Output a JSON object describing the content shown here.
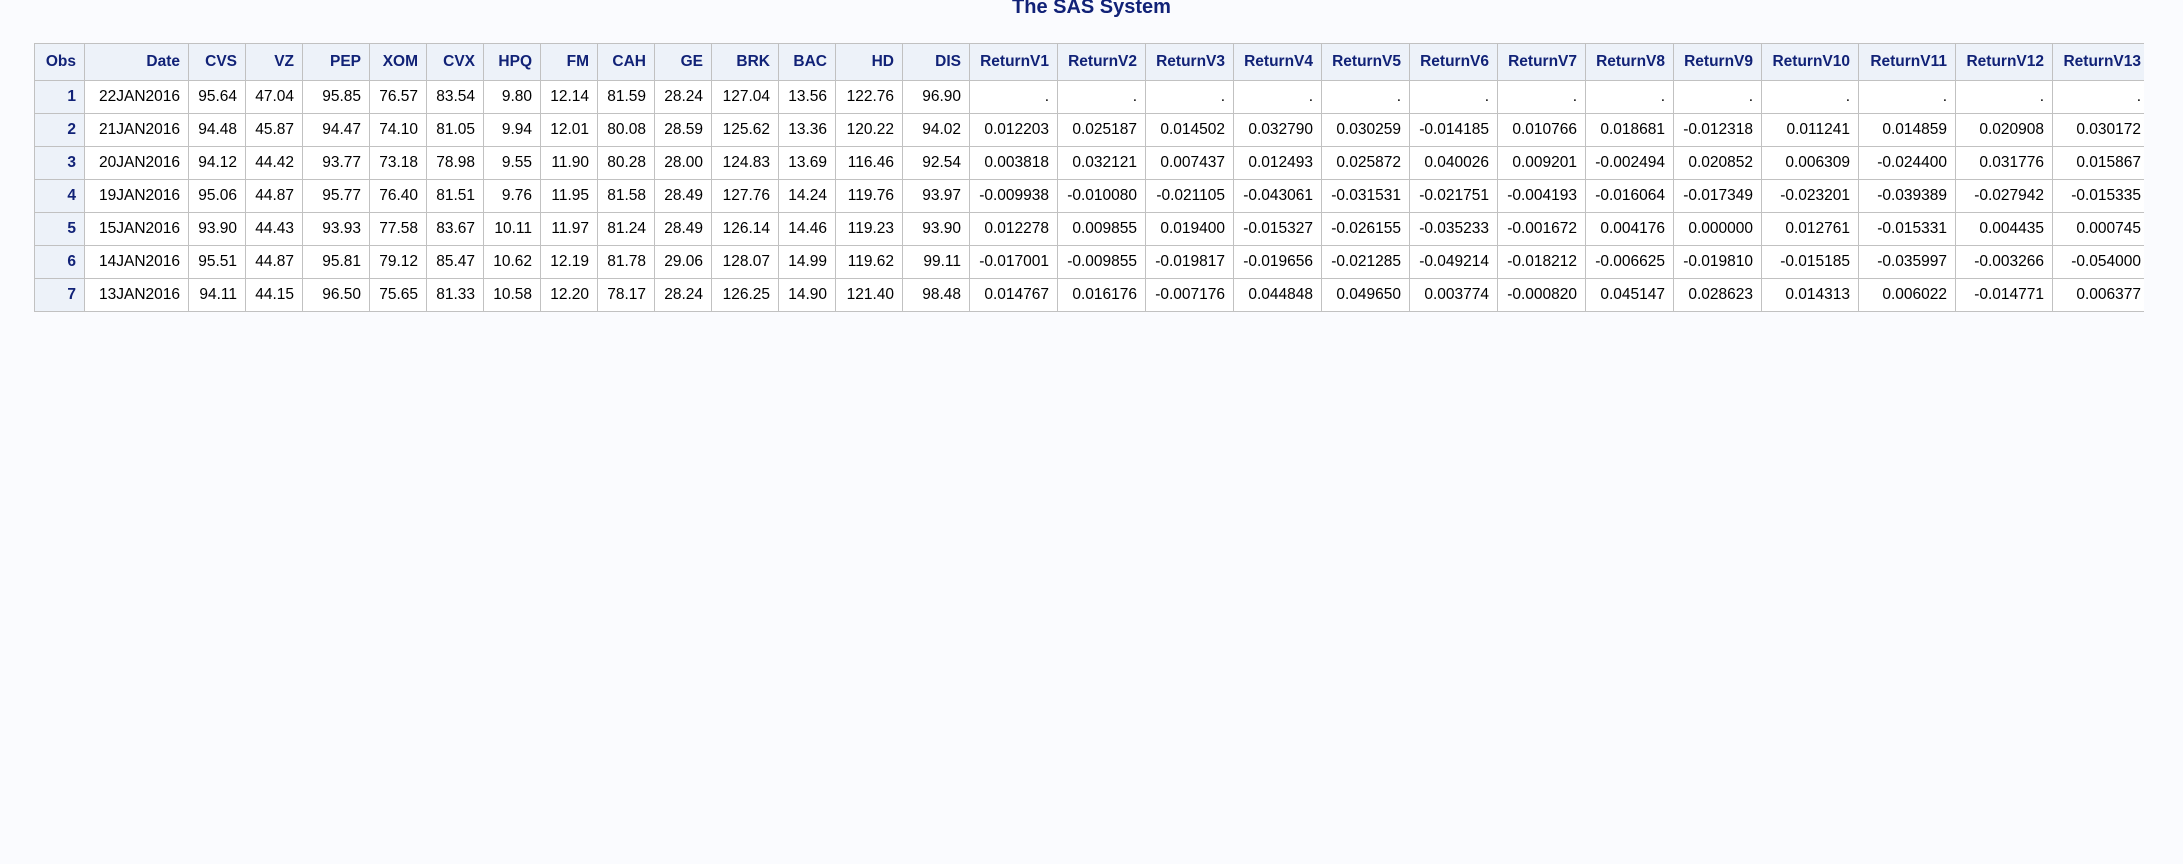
{
  "title": "The SAS System",
  "colors": {
    "header_bg": "#edf2f9",
    "header_text": "#112277",
    "border": "#c1c1c1",
    "page_bg": "#fafbfe"
  },
  "table": {
    "columns": [
      "Obs",
      "Date",
      "CVS",
      "VZ",
      "PEP",
      "XOM",
      "CVX",
      "HPQ",
      "FM",
      "CAH",
      "GE",
      "BRK",
      "BAC",
      "HD",
      "DIS",
      "ReturnV1",
      "ReturnV2",
      "ReturnV3",
      "ReturnV4",
      "ReturnV5",
      "ReturnV6",
      "ReturnV7",
      "ReturnV8",
      "ReturnV9",
      "ReturnV10",
      "ReturnV11",
      "ReturnV12",
      "ReturnV13"
    ],
    "rows": [
      [
        "1",
        "22JAN2016",
        "95.64",
        "47.04",
        "95.85",
        "76.57",
        "83.54",
        "9.80",
        "12.14",
        "81.59",
        "28.24",
        "127.04",
        "13.56",
        "122.76",
        "96.90",
        ".",
        ".",
        ".",
        ".",
        ".",
        ".",
        ".",
        ".",
        ".",
        ".",
        ".",
        ".",
        "."
      ],
      [
        "2",
        "21JAN2016",
        "94.48",
        "45.87",
        "94.47",
        "74.10",
        "81.05",
        "9.94",
        "12.01",
        "80.08",
        "28.59",
        "125.62",
        "13.36",
        "120.22",
        "94.02",
        "0.012203",
        "0.025187",
        "0.014502",
        "0.032790",
        "0.030259",
        "-0.014185",
        "0.010766",
        "0.018681",
        "-0.012318",
        "0.011241",
        "0.014859",
        "0.020908",
        "0.030172"
      ],
      [
        "3",
        "20JAN2016",
        "94.12",
        "44.42",
        "93.77",
        "73.18",
        "78.98",
        "9.55",
        "11.90",
        "80.28",
        "28.00",
        "124.83",
        "13.69",
        "116.46",
        "92.54",
        "0.003818",
        "0.032121",
        "0.007437",
        "0.012493",
        "0.025872",
        "0.040026",
        "0.009201",
        "-0.002494",
        "0.020852",
        "0.006309",
        "-0.024400",
        "0.031776",
        "0.015867"
      ],
      [
        "4",
        "19JAN2016",
        "95.06",
        "44.87",
        "95.77",
        "76.40",
        "81.51",
        "9.76",
        "11.95",
        "81.58",
        "28.49",
        "127.76",
        "14.24",
        "119.76",
        "93.97",
        "-0.009938",
        "-0.010080",
        "-0.021105",
        "-0.043061",
        "-0.031531",
        "-0.021751",
        "-0.004193",
        "-0.016064",
        "-0.017349",
        "-0.023201",
        "-0.039389",
        "-0.027942",
        "-0.015335"
      ],
      [
        "5",
        "15JAN2016",
        "93.90",
        "44.43",
        "93.93",
        "77.58",
        "83.67",
        "10.11",
        "11.97",
        "81.24",
        "28.49",
        "126.14",
        "14.46",
        "119.23",
        "93.90",
        "0.012278",
        "0.009855",
        "0.019400",
        "-0.015327",
        "-0.026155",
        "-0.035233",
        "-0.001672",
        "0.004176",
        "0.000000",
        "0.012761",
        "-0.015331",
        "0.004435",
        "0.000745"
      ],
      [
        "6",
        "14JAN2016",
        "95.51",
        "44.87",
        "95.81",
        "79.12",
        "85.47",
        "10.62",
        "12.19",
        "81.78",
        "29.06",
        "128.07",
        "14.99",
        "119.62",
        "99.11",
        "-0.017001",
        "-0.009855",
        "-0.019817",
        "-0.019656",
        "-0.021285",
        "-0.049214",
        "-0.018212",
        "-0.006625",
        "-0.019810",
        "-0.015185",
        "-0.035997",
        "-0.003266",
        "-0.054000"
      ],
      [
        "7",
        "13JAN2016",
        "94.11",
        "44.15",
        "96.50",
        "75.65",
        "81.33",
        "10.58",
        "12.20",
        "78.17",
        "28.24",
        "126.25",
        "14.90",
        "121.40",
        "98.48",
        "0.014767",
        "0.016176",
        "-0.007176",
        "0.044848",
        "0.049650",
        "0.003774",
        "-0.000820",
        "0.045147",
        "0.028623",
        "0.014313",
        "0.006022",
        "-0.014771",
        "0.006377"
      ]
    ]
  }
}
